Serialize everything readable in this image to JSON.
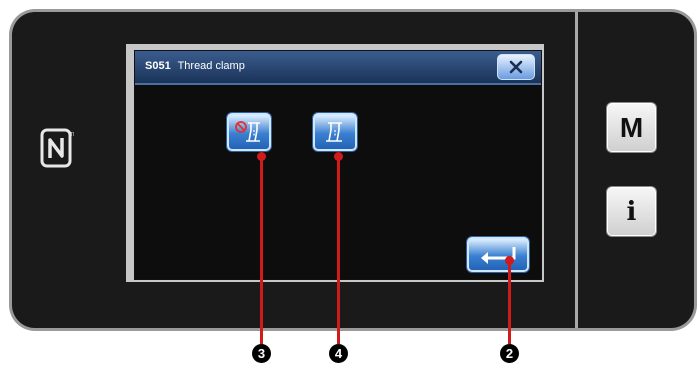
{
  "dialog": {
    "code": "S051",
    "title": "Thread clamp"
  },
  "side_buttons": {
    "menu_label": "M",
    "info_label": "i"
  },
  "callouts": {
    "off_button": "3",
    "on_button": "4",
    "enter_button": "2"
  },
  "colors": {
    "callout": "#d11a1a",
    "button_blue": "#3a7fd0",
    "titlebar": "#1a3358"
  },
  "icons": {
    "nfc": "nfc-icon",
    "close": "close-icon",
    "clamp_off": "thread-clamp-disabled-icon",
    "clamp_on": "thread-clamp-icon",
    "enter": "enter-icon"
  }
}
